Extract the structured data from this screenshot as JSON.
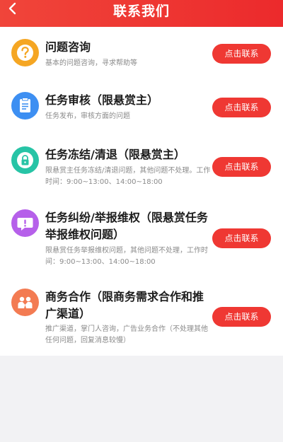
{
  "header": {
    "title": "联系我们",
    "back_icon": "chevron-left-icon"
  },
  "button_label": "点击联系",
  "items": [
    {
      "title": "问题咨询",
      "desc": "基本的问题咨询，寻求帮助等",
      "icon": "question-icon",
      "color": "#f5a623"
    },
    {
      "title": "任务审核（限悬赏主）",
      "desc": "任务发布，审核方面的问题",
      "icon": "document-icon",
      "color": "#3d8ff2"
    },
    {
      "title": "任务冻结/清退（限悬赏主）",
      "desc": "限悬赏主任务冻结/清退问题，其他问题不处理。工作时间：9:00~13:00、14:00~18:00",
      "icon": "lock-icon",
      "color": "#27c4a6"
    },
    {
      "title": "任务纠纷/举报维权（限悬赏任务举报维权问题）",
      "desc": "限悬赏任务举报维权问题，其他问题不处理，工作时间：9:00~13:00、14:00~18:00",
      "icon": "report-chat-icon",
      "color": "#b660ea"
    },
    {
      "title": "商务合作（限商务需求合作和推广渠道）",
      "desc": "推广渠道，掌门人咨询，广告业务合作（不处理其他任何问题，回复消息较慢）",
      "icon": "partners-icon",
      "color": "#f37b52"
    }
  ]
}
